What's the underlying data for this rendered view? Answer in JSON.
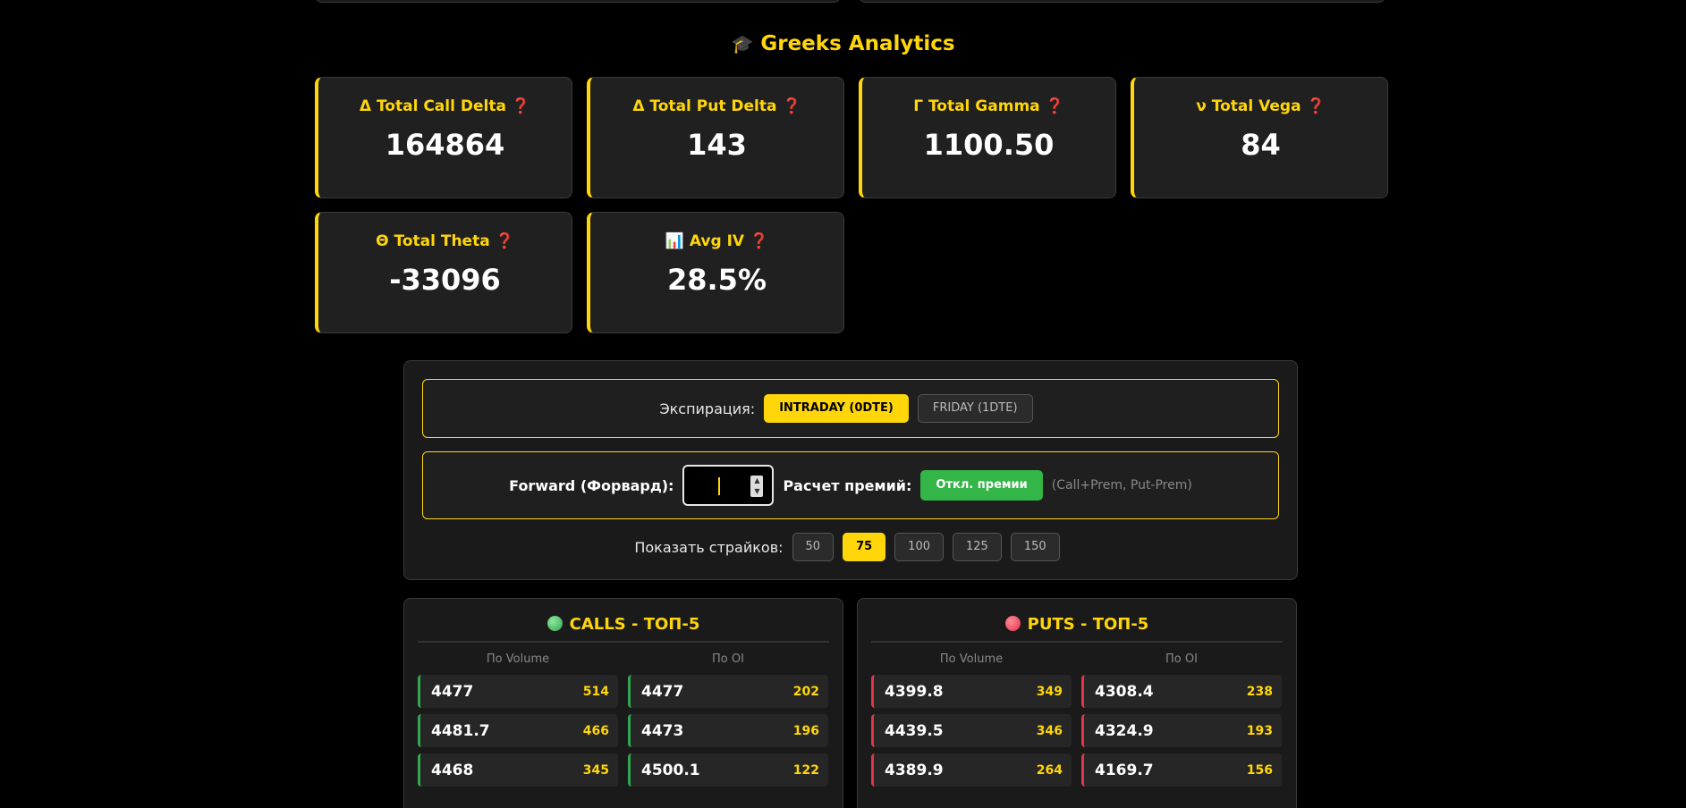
{
  "greeks": {
    "title": "Greeks Analytics",
    "title_icon": "🎓",
    "help_icon": "❓",
    "cards": [
      {
        "label": "Δ Total Call Delta",
        "value": "164864"
      },
      {
        "label": "Δ Total Put Delta",
        "value": "143"
      },
      {
        "label": "Γ Total Gamma",
        "value": "1100.50"
      },
      {
        "label": "ν Total Vega",
        "value": "84"
      },
      {
        "label": "Θ Total Theta",
        "value": "-33096"
      },
      {
        "label": "📊 Avg IV",
        "value": "28.5%"
      }
    ]
  },
  "controls": {
    "expiration_label": "Экспирация:",
    "expiration_options": [
      "INTRADAY (0DTE)",
      "FRIDAY (1DTE)"
    ],
    "expiration_selected": "INTRADAY (0DTE)",
    "forward_label": "Forward (Форвард):",
    "forward_value": "",
    "premium_label": "Расчет премий:",
    "premium_button": "Откл. премии",
    "premium_hint": "(Call+Prem, Put-Prem)",
    "strikes_label": "Показать страйков:",
    "strikes_options": [
      "50",
      "75",
      "100",
      "125",
      "150"
    ],
    "strikes_selected": "75"
  },
  "calls": {
    "title": "CALLS - ТОП-5",
    "col_volume": "По Volume",
    "col_oi": "По OI",
    "by_volume": [
      {
        "strike": "4477",
        "count": "514"
      },
      {
        "strike": "4481.7",
        "count": "466"
      },
      {
        "strike": "4468",
        "count": "345"
      }
    ],
    "by_oi": [
      {
        "strike": "4477",
        "count": "202"
      },
      {
        "strike": "4473",
        "count": "196"
      },
      {
        "strike": "4500.1",
        "count": "122"
      }
    ]
  },
  "puts": {
    "title": "PUTS - ТОП-5",
    "col_volume": "По Volume",
    "col_oi": "По OI",
    "by_volume": [
      {
        "strike": "4399.8",
        "count": "349"
      },
      {
        "strike": "4439.5",
        "count": "346"
      },
      {
        "strike": "4389.9",
        "count": "264"
      }
    ],
    "by_oi": [
      {
        "strike": "4308.4",
        "count": "238"
      },
      {
        "strike": "4324.9",
        "count": "193"
      },
      {
        "strike": "4169.7",
        "count": "156"
      }
    ]
  },
  "colors": {
    "accent": "#ffd60a",
    "call": "#2fa84f",
    "put": "#e0354a",
    "green_button": "#34b548"
  }
}
